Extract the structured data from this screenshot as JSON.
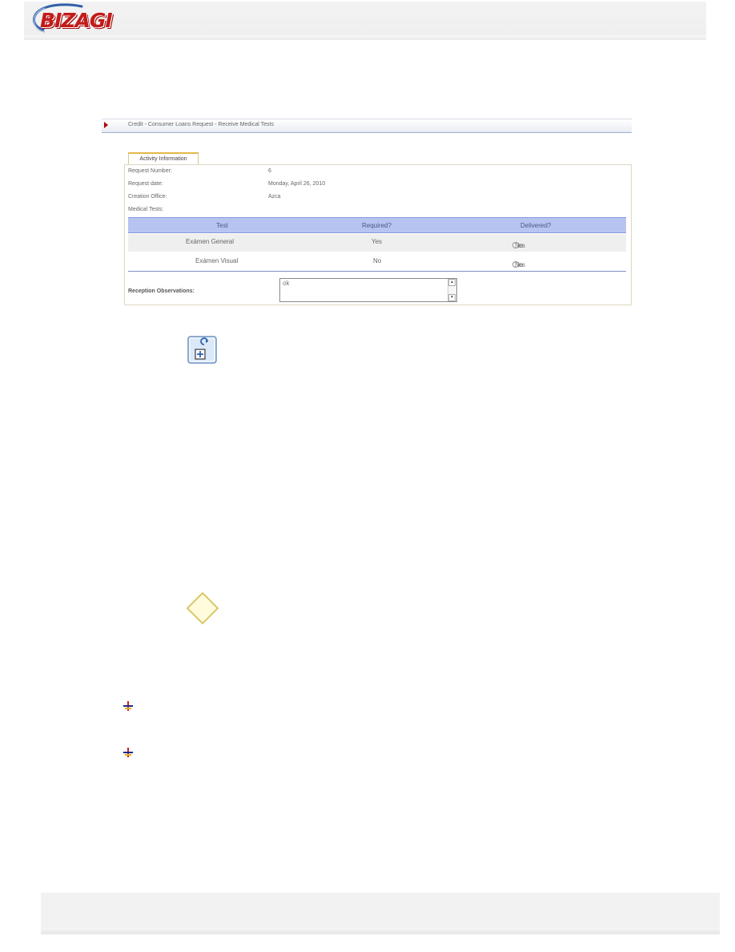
{
  "brand": {
    "logo_text": "BIZAGI",
    "color": "#c41a1a"
  },
  "breadcrumb": {
    "text": "Credit - Consumer Loans Request - Receive Medical Tests"
  },
  "tab": {
    "label": "Activity Information"
  },
  "fields": [
    {
      "label": "Request Number:",
      "value": "6"
    },
    {
      "label": "Request date:",
      "value": "Monday, April 26, 2010"
    },
    {
      "label": "Creation Office:",
      "value": "Azca"
    },
    {
      "label": "Medical Tests:",
      "value": ""
    }
  ],
  "grid": {
    "headers": {
      "test": "Test",
      "required": "Required?",
      "delivered": "Delivered?"
    },
    "rows": [
      {
        "test": "Exámen General",
        "required": "Yes",
        "delivered": "Yes"
      },
      {
        "test": "Exámen Visual",
        "required": "No",
        "delivered": "Yes"
      }
    ],
    "options": {
      "yes": "Yes",
      "no": "No"
    }
  },
  "observations": {
    "label": "Reception Observations:",
    "value": "ok"
  },
  "icons": {
    "subprocess": "subprocess-icon",
    "gateway": "gateway-icon",
    "plus": "plus-icon"
  }
}
